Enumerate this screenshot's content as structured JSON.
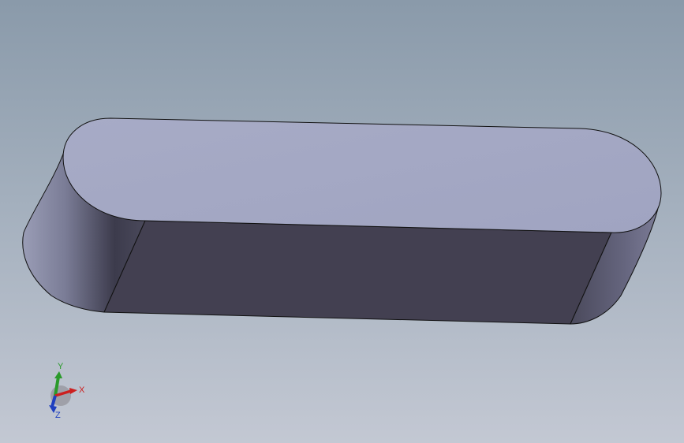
{
  "viewport": {
    "background_top": "#8a9aaa",
    "background_bottom": "#c3c8d3"
  },
  "model": {
    "shape": "rounded-end-key",
    "top_face_color": "#a3a8c4",
    "front_face_color": "#434051",
    "end_face_color": "#5a5a70",
    "edge_color": "#111111"
  },
  "triad": {
    "x_label": "X",
    "y_label": "Y",
    "z_label": "Z",
    "x_color": "#cc1f1f",
    "y_color": "#2a9a2a",
    "z_color": "#1f3fbf"
  }
}
